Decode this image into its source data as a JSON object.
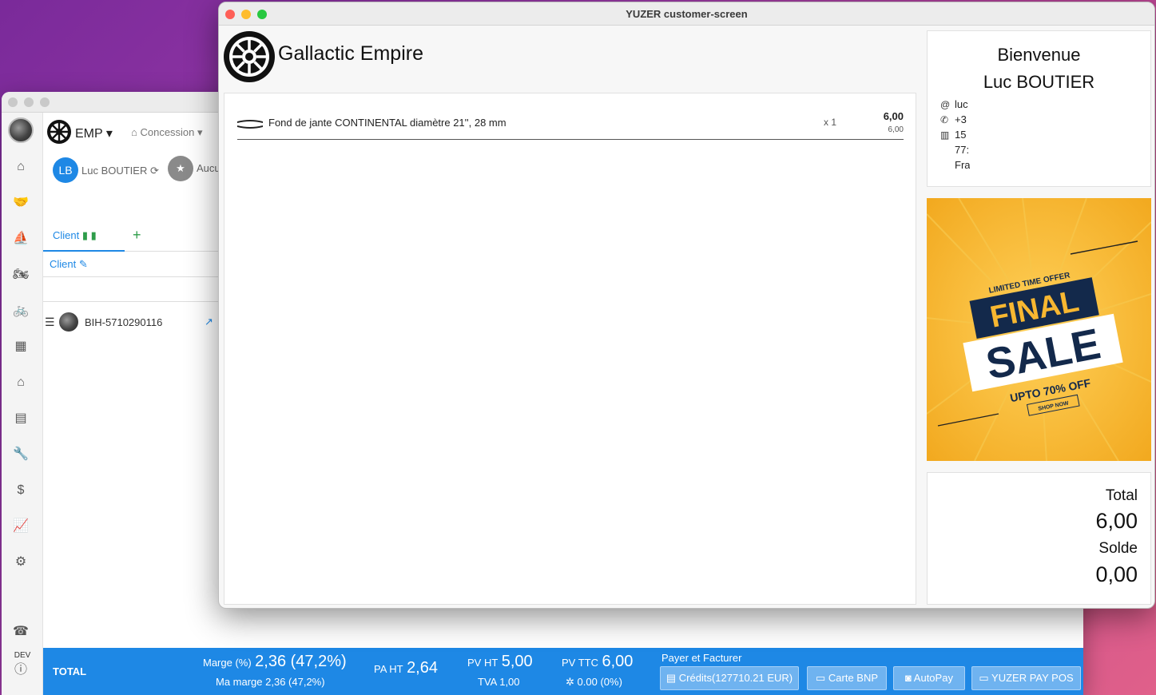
{
  "back_window": {
    "top_bar": {
      "org": "EMP",
      "concession_label": "Concession"
    },
    "client_bar": {
      "initials": "LB",
      "client_name": "Luc BOUTIER",
      "aucun_label": "Aucu"
    },
    "tabs": {
      "client_tab": "Client",
      "add": "+"
    },
    "client_link": "Client",
    "vehicle": {
      "id": "BIH-5710290116"
    },
    "sidebar": {
      "dev_label": "DEV"
    },
    "total_bar": {
      "label": "TOTAL",
      "marge_label": "Marge (%)",
      "marge_value": "2,36 (47,2%)",
      "ma_marge": "Ma marge 2,36 (47,2%)",
      "pa_ht_label": "PA HT",
      "pa_ht_value": "2,64",
      "pv_ht_label": "PV HT",
      "pv_ht_value": "5,00",
      "tva": "TVA 1,00",
      "pv_ttc_label": "PV TTC",
      "pv_ttc_value": "6,00",
      "tax_extra": "0.00 (0%)",
      "payer_label": "Payer et Facturer",
      "buttons": {
        "credits": "Crédits(127710.21 EUR)",
        "carte": "Carte BNP",
        "autopay": "AutoPay",
        "yuzer_pay": "YUZER PAY POS"
      }
    }
  },
  "front_window": {
    "title": "YUZER customer-screen",
    "brand_name": "Gallactic Empire",
    "cart": {
      "items": [
        {
          "name": "Fond de jante CONTINENTAL diamètre 21'', 28 mm",
          "qty": "x 1",
          "price": "6,00",
          "unit_price": "6,00"
        }
      ]
    },
    "welcome": {
      "title": "Bienvenue",
      "name": "Luc BOUTIER",
      "email": "luc",
      "phone": "+3",
      "address_1": "15",
      "address_2": "77:",
      "address_3": "Fra"
    },
    "promo": {
      "limited": "LIMITED TIME OFFER",
      "final": "FINAL",
      "sale": "SALE",
      "upto": "UPTO 70% OFF",
      "shop": "SHOP NOW"
    },
    "totals": {
      "total_label": "Total",
      "total_value": "6,00",
      "solde_label": "Solde",
      "solde_value": "0,00"
    }
  },
  "colors": {
    "accent": "#1e88e5",
    "promo_bg": "#f7b731",
    "promo_dark": "#13294b"
  }
}
